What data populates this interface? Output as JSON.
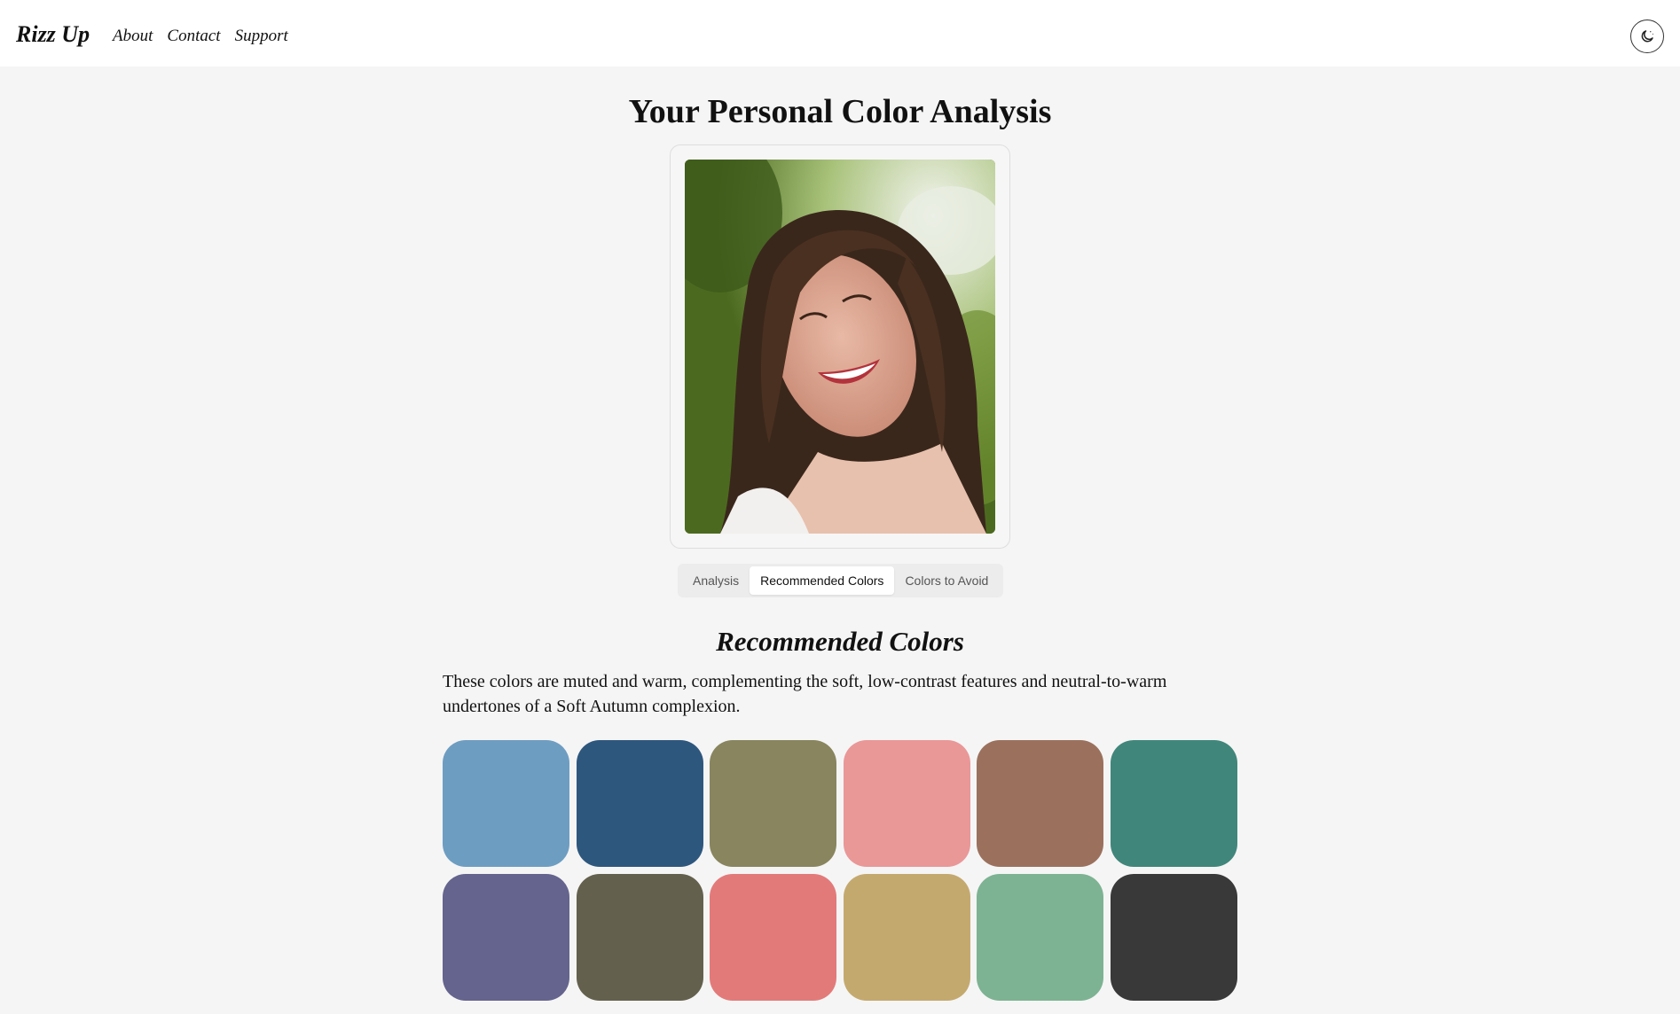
{
  "header": {
    "brand": "Rizz Up",
    "nav": [
      "About",
      "Contact",
      "Support"
    ],
    "theme_toggle_icon": "moon-icon"
  },
  "page": {
    "title": "Your Personal Color Analysis"
  },
  "photo": {
    "icon": "portrait-photo"
  },
  "tabs": [
    {
      "label": "Analysis",
      "active": false
    },
    {
      "label": "Recommended Colors",
      "active": true
    },
    {
      "label": "Colors to Avoid",
      "active": false
    }
  ],
  "section": {
    "title": "Recommended Colors",
    "description": "These colors are muted and warm, complementing the soft, low-contrast features and neutral-to-warm undertones of a Soft Autumn complexion."
  },
  "swatches": [
    "#6e9dc2",
    "#2e577e",
    "#88855f",
    "#ea9798",
    "#9b715e",
    "#40867b",
    "#64648e",
    "#63604d",
    "#e37a7a",
    "#c4a96f",
    "#7db393",
    "#393939"
  ]
}
